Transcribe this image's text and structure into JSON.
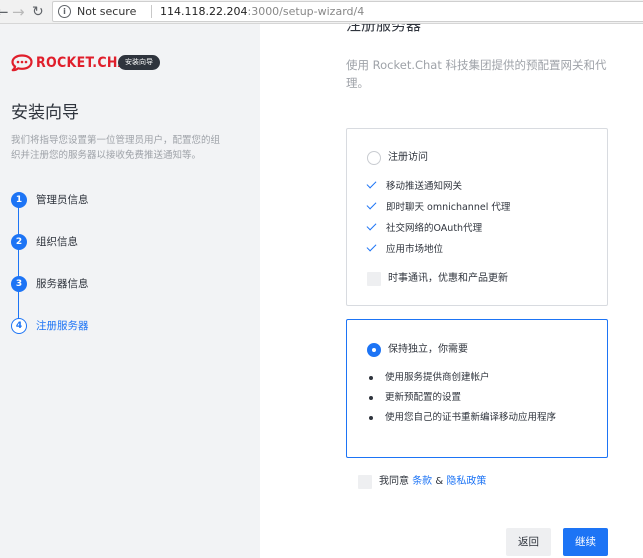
{
  "browser": {
    "secure_label": "Not secure",
    "url_host": "114.118.22.204",
    "url_path": ":3000/setup-wizard/4"
  },
  "sidebar": {
    "logo_text": "ROCKET.CHAT",
    "badge": "安装向导",
    "title": "安装向导",
    "description": "我们将指导您设置第一位管理员用户，配置您的组织并注册您的服务器以接收免费推送通知等。",
    "steps": [
      {
        "number": "1",
        "label": "管理员信息"
      },
      {
        "number": "2",
        "label": "组织信息"
      },
      {
        "number": "3",
        "label": "服务器信息"
      },
      {
        "number": "4",
        "label": "注册服务器"
      }
    ]
  },
  "main": {
    "cut_heading": "注册服务器",
    "intro": "使用 Rocket.Chat 科技集团提供的预配置网关和代理。",
    "option1": {
      "title": "注册访问",
      "features": [
        "移动推送通知网关",
        "即时聊天 omnichannel 代理",
        "社交网络的OAuth代理",
        "应用市场地位"
      ],
      "newsletter_label": "时事通讯，优惠和产品更新"
    },
    "option2": {
      "title": "保持独立，你需要",
      "bullets": [
        "使用服务提供商创建帐户",
        "更新预配置的设置",
        "使用您自己的证书重新编译移动应用程序"
      ]
    },
    "agree": {
      "prefix": "我同意",
      "terms": "条款",
      "amp": "&",
      "privacy": "隐私政策"
    },
    "back_label": "返回",
    "next_label": "继续"
  },
  "colors": {
    "accent": "#1d74f5",
    "brand": "#e01e2b",
    "muted_text": "#9ea2a8"
  }
}
